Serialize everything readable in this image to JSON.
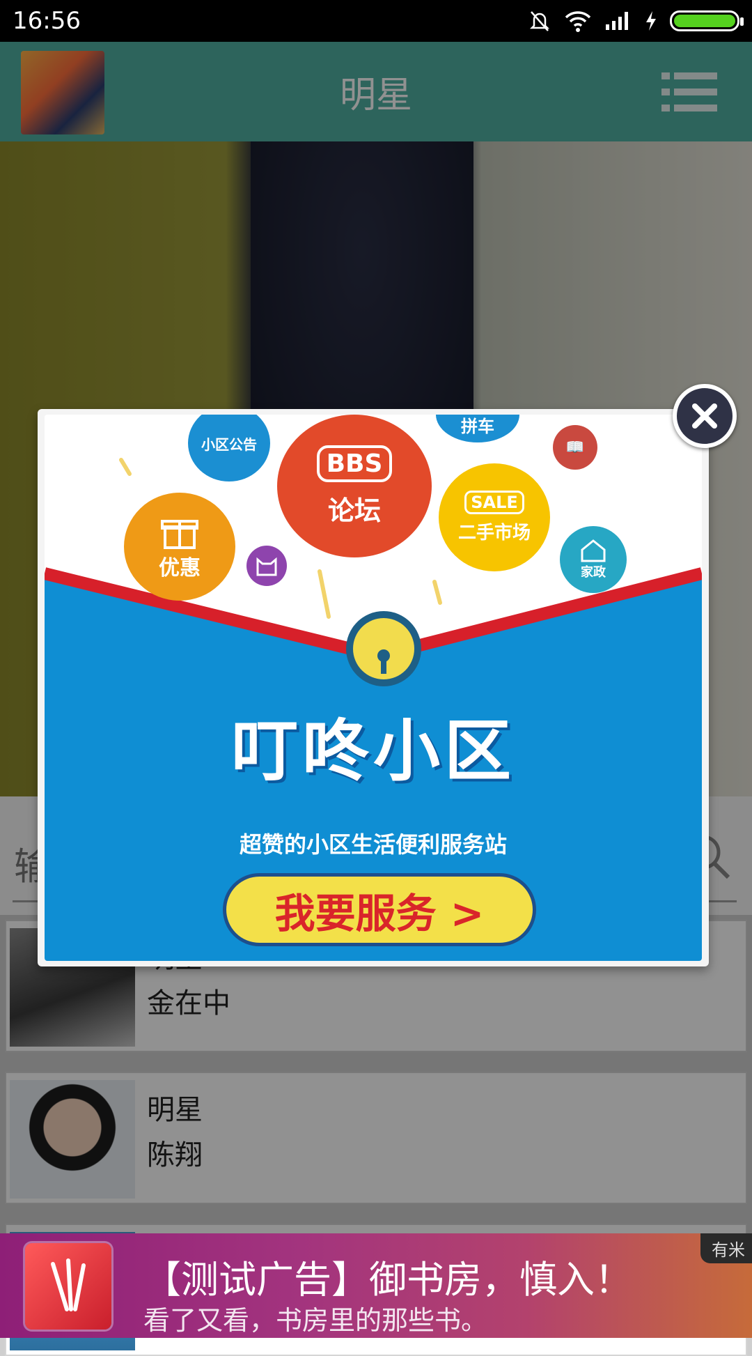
{
  "status_bar": {
    "time": "16:56"
  },
  "header": {
    "title": "明星"
  },
  "search": {
    "placeholder": "输"
  },
  "list": {
    "items": [
      {
        "category": "明星",
        "name": "金在中"
      },
      {
        "category": "明星",
        "name": "陈翔"
      }
    ]
  },
  "popup_ad": {
    "bubbles": {
      "notice": "小区公告",
      "bbs_tag": "BBS",
      "bbs": "论坛",
      "carpool": "拼车",
      "book": "📖",
      "gift": "优惠",
      "sale_tag": "SALE",
      "sale": "二手市场",
      "house": "家政"
    },
    "brand": "叮咚小区",
    "slogan": "超赞的小区生活便利服务站",
    "cta": "我要服务 >"
  },
  "bottom_ad": {
    "headline": "【测试广告】御书房，慎入！",
    "subline": "看了又看，书房里的那些书。",
    "badge": "有米"
  },
  "colors": {
    "header": "#4fb0a3",
    "popup_blue": "#0f8ed3",
    "popup_red": "#d7202a",
    "cta_yellow": "#f3e049",
    "ad_purple": "#8e1f77"
  }
}
